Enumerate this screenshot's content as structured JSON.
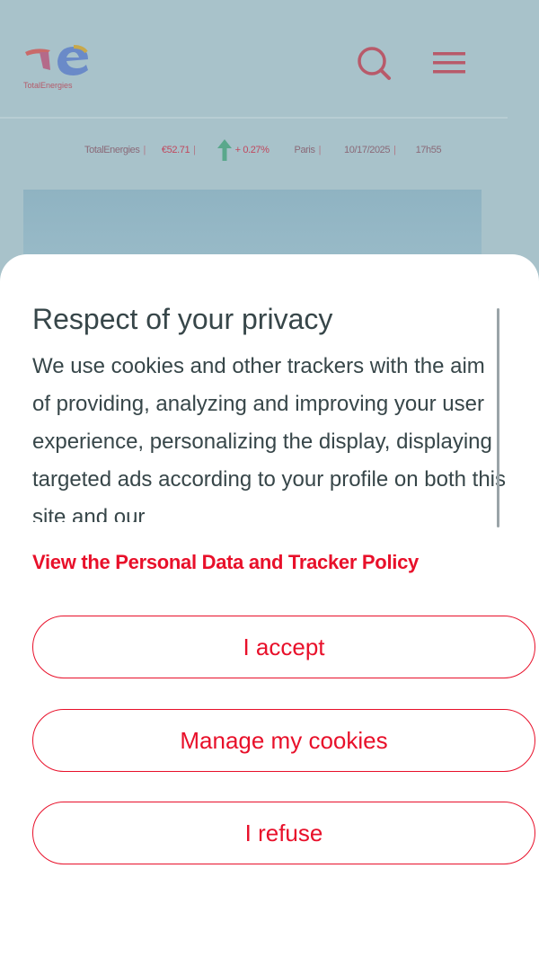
{
  "header": {
    "logo_text": "TotalEnergies"
  },
  "ticker": {
    "company": "TotalEnergies",
    "price": "€52.71",
    "change": "+ 0.27%",
    "city": "Paris",
    "date": "10/17/2025",
    "time": "17h55"
  },
  "cookie_banner": {
    "title": "Respect of your privacy",
    "body": "We use cookies and other trackers with the aim of providing, analyzing and improving your user experience, personalizing the display, displaying targeted ads according to your profile on both this site and our",
    "policy_link": "View the Personal Data and Tracker Policy",
    "accept_label": "I accept",
    "manage_label": "Manage my cookies",
    "refuse_label": "I refuse"
  },
  "colors": {
    "accent": "#e8102a",
    "text": "#374649",
    "overlay": "#a8c2ca"
  }
}
